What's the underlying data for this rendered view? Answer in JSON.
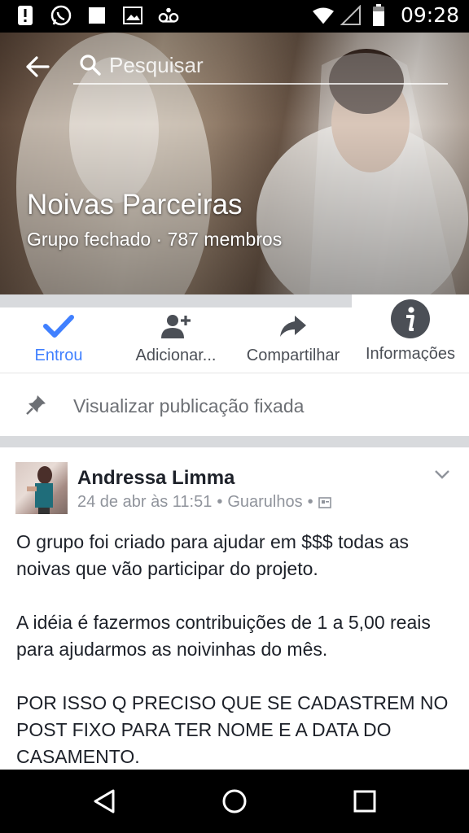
{
  "status_bar": {
    "time": "09:28",
    "icons": [
      "alert-icon",
      "whatsapp-icon",
      "notification-square-icon",
      "image-icon",
      "voicemail-icon",
      "wifi-icon",
      "signal-icon",
      "battery-icon"
    ]
  },
  "header": {
    "search_placeholder": "Pesquisar",
    "group_name": "Noivas Parceiras",
    "group_meta": "Grupo fechado · 787 membros"
  },
  "actions": {
    "joined_label": "Entrou",
    "add_label": "Adicionar...",
    "share_label": "Compartilhar",
    "info_label": "Informações",
    "accent_color": "#4080ff"
  },
  "pinned": {
    "label": "Visualizar publicação fixada"
  },
  "post": {
    "author": "Andressa Limma",
    "date": "24 de abr às 11:51",
    "location": "Guarulhos",
    "paragraphs": [
      "O grupo foi criado para ajudar em $$$ todas as noivas que vão participar do projeto.",
      "A idéia é fazermos contribuições de 1 a 5,00 reais para ajudarmos as noivinhas do mês.",
      "POR ISSO Q PRECISO QUE SE CADASTREM NO POST FIXO PARA TER NOME E A DATA DO CASAMENTO."
    ]
  },
  "nav_bar": {
    "icons": [
      "back-triangle-icon",
      "home-circle-icon",
      "recents-square-icon"
    ]
  }
}
